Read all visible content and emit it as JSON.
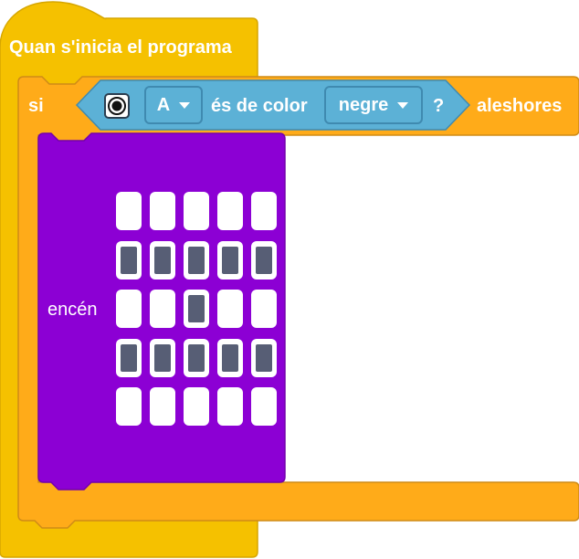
{
  "colors": {
    "events": "#f5c100",
    "events_border": "#d6a600",
    "control": "#ffab19",
    "control_border": "#cf8b17",
    "sensing": "#5cb1d6",
    "sensing_border": "#3f8ab0",
    "display": "#8c00d4",
    "led_on": "#575e75",
    "led_off": "#ffffff"
  },
  "hat_block": {
    "label": "Quan s'inicia el programa"
  },
  "if_block": {
    "if_label": "si",
    "then_label": "aleshores"
  },
  "condition": {
    "sensor_icon": "color-sensor-icon",
    "port": "A",
    "text": "és de color",
    "color": "negre",
    "question": "?"
  },
  "display_block": {
    "label": "encén",
    "matrix": [
      [
        0,
        0,
        0,
        0,
        0
      ],
      [
        1,
        1,
        1,
        1,
        1
      ],
      [
        0,
        0,
        1,
        0,
        0
      ],
      [
        1,
        1,
        1,
        1,
        1
      ],
      [
        0,
        0,
        0,
        0,
        0
      ]
    ]
  }
}
